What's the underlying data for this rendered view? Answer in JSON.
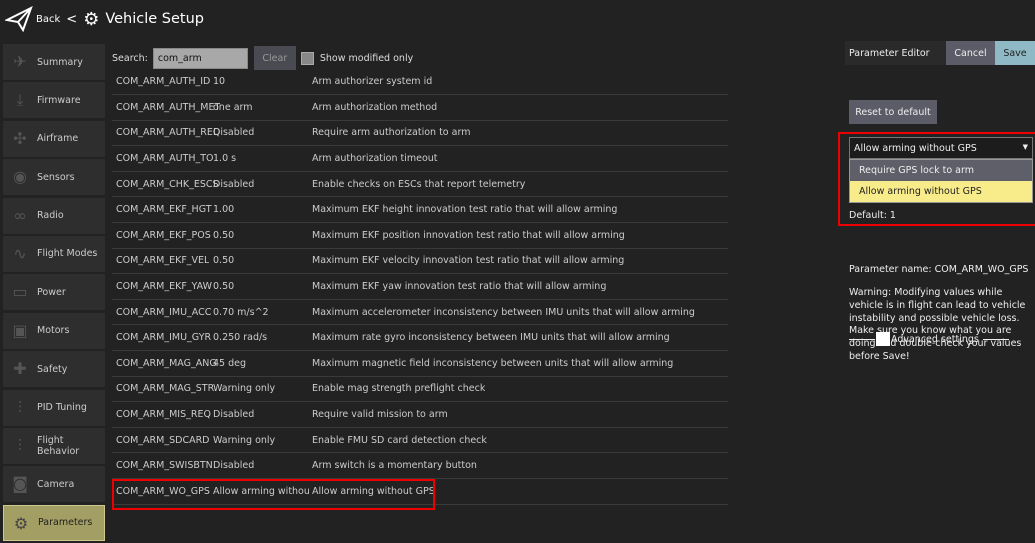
{
  "header": {
    "back": "Back",
    "separator": "<",
    "title": "Vehicle Setup"
  },
  "sidebar": [
    {
      "label": "Summary",
      "icon": "paper-plane-icon"
    },
    {
      "label": "Firmware",
      "icon": "download-icon"
    },
    {
      "label": "Airframe",
      "icon": "airframe-icon"
    },
    {
      "label": "Sensors",
      "icon": "sensors-icon"
    },
    {
      "label": "Radio",
      "icon": "radio-icon"
    },
    {
      "label": "Flight Modes",
      "icon": "flight-modes-icon"
    },
    {
      "label": "Power",
      "icon": "battery-icon"
    },
    {
      "label": "Motors",
      "icon": "motors-icon"
    },
    {
      "label": "Safety",
      "icon": "safety-icon"
    },
    {
      "label": "PID Tuning",
      "icon": "sliders-icon"
    },
    {
      "label": "Flight Behavior",
      "icon": "sliders-icon"
    },
    {
      "label": "Camera",
      "icon": "camera-icon"
    },
    {
      "label": "Parameters",
      "icon": "gears-icon",
      "selected": true
    }
  ],
  "search": {
    "label": "Search:",
    "value": "com_arm",
    "clear": "Clear",
    "modified_only": "Show modified only"
  },
  "params": [
    [
      "COM_ARM_AUTH_ID",
      "10",
      "Arm authorizer system id"
    ],
    [
      "COM_ARM_AUTH_MET",
      "one arm",
      "Arm authorization method"
    ],
    [
      "COM_ARM_AUTH_REQ",
      "Disabled",
      "Require arm authorization to arm"
    ],
    [
      "COM_ARM_AUTH_TO",
      "1.0 s",
      "Arm authorization timeout"
    ],
    [
      "COM_ARM_CHK_ESCS",
      "Disabled",
      "Enable checks on ESCs that report telemetry"
    ],
    [
      "COM_ARM_EKF_HGT",
      "1.00",
      "Maximum EKF height innovation test ratio that will allow arming"
    ],
    [
      "COM_ARM_EKF_POS",
      "0.50",
      "Maximum EKF position innovation test ratio that will allow arming"
    ],
    [
      "COM_ARM_EKF_VEL",
      "0.50",
      "Maximum EKF velocity innovation test ratio that will allow arming"
    ],
    [
      "COM_ARM_EKF_YAW",
      "0.50",
      "Maximum EKF yaw innovation test ratio that will allow arming"
    ],
    [
      "COM_ARM_IMU_ACC",
      "0.70 m/s^2",
      "Maximum accelerometer inconsistency between IMU units that will allow arming"
    ],
    [
      "COM_ARM_IMU_GYR",
      "0.250 rad/s",
      "Maximum rate gyro inconsistency between IMU units that will allow arming"
    ],
    [
      "COM_ARM_MAG_ANG",
      "45 deg",
      "Maximum magnetic field inconsistency between units that will allow arming"
    ],
    [
      "COM_ARM_MAG_STR",
      "Warning only",
      "Enable mag strength preflight check"
    ],
    [
      "COM_ARM_MIS_REQ",
      "Disabled",
      "Require valid mission to arm"
    ],
    [
      "COM_ARM_SDCARD",
      "Warning only",
      "Enable FMU SD card detection check"
    ],
    [
      "COM_ARM_SWISBTN",
      "Disabled",
      "Arm switch is a momentary button"
    ],
    [
      "COM_ARM_WO_GPS",
      "Allow arming without GPS",
      "Allow arming without GPS"
    ]
  ],
  "editor": {
    "title": "Parameter Editor",
    "cancel": "Cancel",
    "save": "Save",
    "reset": "Reset to default",
    "selected_value": "Allow arming without GPS",
    "options": [
      "Require GPS lock to arm",
      "Allow arming without GPS"
    ],
    "default": "Default: 1",
    "param_name": "Parameter name: COM_ARM_WO_GPS",
    "warning": "Warning: Modifying values while vehicle is in flight can lead to vehicle instability and possible vehicle loss. Make sure you know what you are doing and double-check your values before Save!",
    "advanced": "Advanced settings"
  },
  "colors": {
    "highlight": "#ee0000",
    "selected_sidebar": "#a39e63",
    "selected_option": "#f8ec8a",
    "save": "#8fb9c4"
  }
}
